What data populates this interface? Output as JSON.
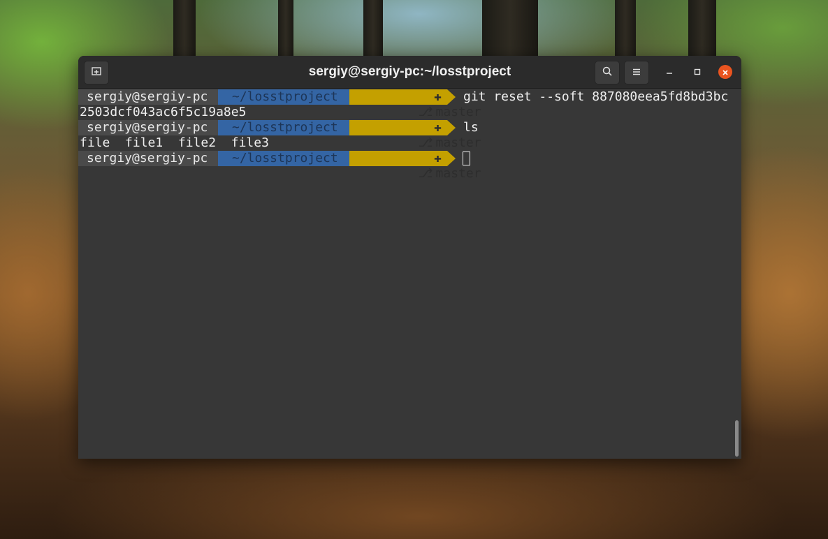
{
  "window": {
    "title": "sergiy@sergiy-pc:~/losstproject"
  },
  "icons": {
    "new_tab": "new-tab-icon",
    "search": "search-icon",
    "menu": "hamburger-menu-icon",
    "minimize": "minimize-icon",
    "maximize": "maximize-icon",
    "close": "close-icon"
  },
  "colors": {
    "terminal_bg": "#373737",
    "titlebar_bg": "#2b2b2b",
    "user_segment": "#4a4a4a",
    "path_segment": "#3465a4",
    "git_segment": "#c4a000",
    "close_button": "#e95420"
  },
  "prompt": {
    "user": "sergiy@sergiy-pc",
    "path": "~/losstproject",
    "branch": "master"
  },
  "lines": {
    "cmd1": "git reset --soft 887080eea5fd8bd3bc",
    "cmd1_wrap": "2503dcf043ac6f5c19a8e5",
    "cmd2": "ls",
    "output_ls": "file  file1  file2  file3"
  }
}
